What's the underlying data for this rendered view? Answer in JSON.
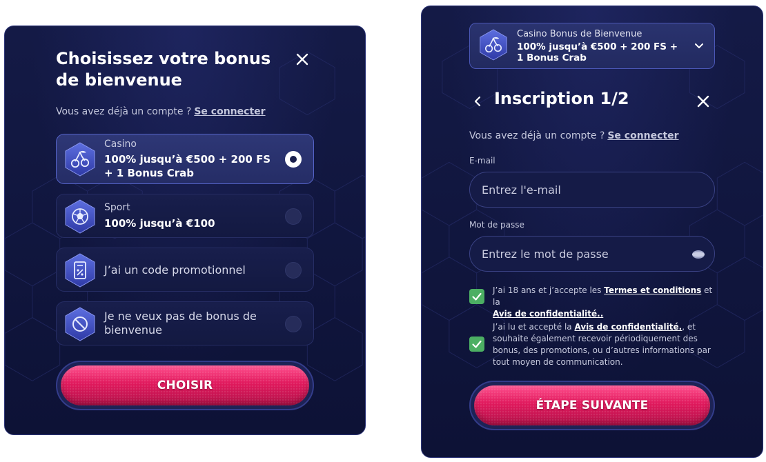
{
  "left": {
    "title": "Choisissez votre bonus de bienvenue",
    "account_prompt": "Vous avez déjà un compte ?",
    "login_link": "Se connecter",
    "options": [
      {
        "category": "Casino",
        "value": "100% jusqu’à €500 + 200 FS + 1 Bonus Crab",
        "icon": "cherry-icon",
        "selected": true
      },
      {
        "category": "Sport",
        "value": "100% jusqu’à €100",
        "icon": "soccer-ball-icon",
        "selected": false
      },
      {
        "label": "J’ai un code promotionnel",
        "icon": "promo-code-icon",
        "selected": false
      },
      {
        "label": "Je ne veux pas de bonus de bienvenue",
        "icon": "no-bonus-icon",
        "selected": false
      }
    ],
    "cta": "CHOISIR"
  },
  "right": {
    "bonus_dropdown": {
      "category": "Casino Bonus de Bienvenue",
      "value": "100% jusqu’à €500 + 200 FS + 1 Bonus Crab",
      "icon": "cherry-icon"
    },
    "title": "Inscription 1/2",
    "account_prompt": "Vous avez déjà un compte ?",
    "login_link": "Se connecter",
    "email_label": "E-mail",
    "email_placeholder": "Entrez l'e-mail",
    "password_label": "Mot de passe",
    "password_placeholder": "Entrez le mot de passe",
    "consent1": {
      "checked": true,
      "text_before": "J’ai 18 ans et j’accepte les",
      "terms_link": "Termes et conditions",
      "text_middle": "et la",
      "privacy_link": "Avis de confidentialité.."
    },
    "consent2": {
      "checked": true,
      "text_before": "J’ai lu et accepté la",
      "privacy_link": "Avis de confidentialité.",
      "text_after": ", et souhaite également recevoir périodiquement des bonus, des promotions, ou d’autres informations par tout moyen de communication."
    },
    "cta": "ÉTAPE SUIVANTE"
  },
  "colors": {
    "panel_bg": "#10163d",
    "accent_pink": "#e0185c",
    "check_green": "#4caf63",
    "selected_border": "#5563c8"
  }
}
